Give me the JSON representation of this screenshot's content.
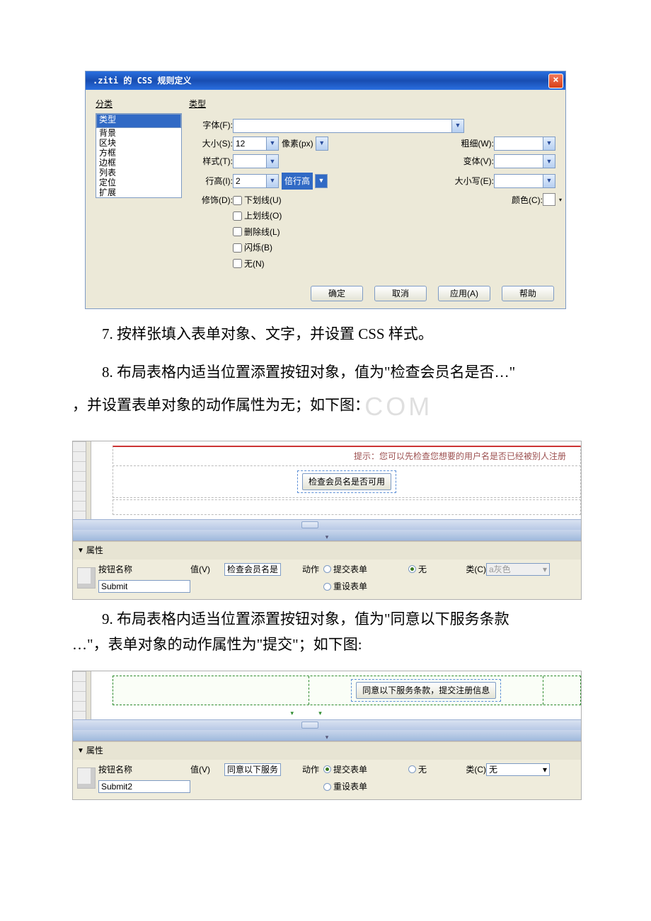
{
  "dialog": {
    "title": ".ziti 的 CSS 规则定义",
    "category_header": "分类",
    "categories": [
      "类型",
      "背景",
      "区块",
      "方框",
      "边框",
      "列表",
      "定位",
      "扩展"
    ],
    "section_header": "类型",
    "labels": {
      "font": "字体(F):",
      "size": "大小(S):",
      "style": "样式(T):",
      "lineheight": "行高(I):",
      "decoration": "修饰(D):",
      "weight": "粗细(W):",
      "variant": "变体(V):",
      "case": "大小写(E):",
      "color": "颜色(C):",
      "unit_px": "像素(px)",
      "unit_lh": "倍行高"
    },
    "values": {
      "size": "12",
      "lineheight": "2"
    },
    "checks": [
      "下划线(U)",
      "上划线(O)",
      "删除线(L)",
      "闪烁(B)",
      "无(N)"
    ],
    "buttons": {
      "ok": "确定",
      "cancel": "取消",
      "apply": "应用(A)",
      "help": "帮助"
    }
  },
  "paragraphs": {
    "p7": "7. 按样张填入表单对象、文字，并设置 CSS 样式。",
    "p8a": "8. 布局表格内适当位置添置按钮对象，值为\"检查会员名是否…\"",
    "p8b": "，并设置表单对象的动作属性为无；如下图：",
    "p9a": "9. 布局表格内适当位置添置按钮对象，值为\"同意以下服务条款",
    "p9b": "…\"，表单对象的动作属性为\"提交\"；如下图:"
  },
  "panel1": {
    "hint": "提示：您可以先检查您想要的用户名是否已经被别人注册",
    "button_caption": "检查会员名是否可用",
    "props_header": "属性",
    "labels": {
      "name": "按钮名称",
      "value": "值(V)",
      "action": "动作",
      "class": "类(C)"
    },
    "name_value": "Submit",
    "value_value": "检查会员名是否",
    "actions": {
      "submit": "提交表单",
      "reset": "重设表单",
      "none": "无"
    },
    "class_value": "a灰色"
  },
  "panel2": {
    "button_caption": "同意以下服务条款，提交注册信息",
    "props_header": "属性",
    "labels": {
      "name": "按钮名称",
      "value": "值(V)",
      "action": "动作",
      "class": "类(C)"
    },
    "name_value": "Submit2",
    "value_value": "同意以下服务条",
    "actions": {
      "submit": "提交表单",
      "reset": "重设表单",
      "none": "无"
    },
    "class_value": "无"
  },
  "watermark": "COM"
}
